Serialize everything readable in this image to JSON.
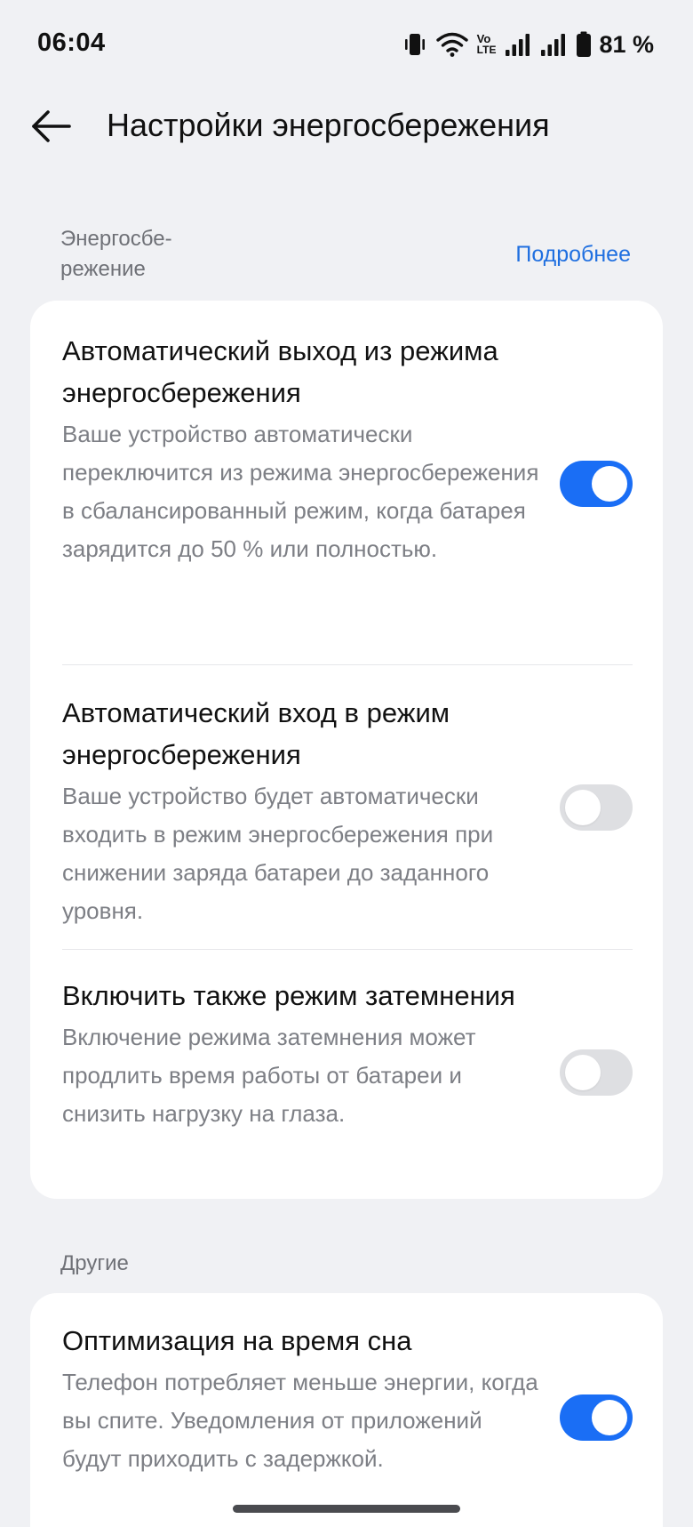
{
  "status_bar": {
    "time": "06:04",
    "battery": "81 %",
    "volte_line1": "Vo",
    "volte_line2": "LTE",
    "icons": [
      "vibrate-icon",
      "wifi-icon",
      "volte-icon",
      "signal-1-icon",
      "signal-2-icon",
      "battery-icon"
    ]
  },
  "header": {
    "back_icon": "arrow-left-icon",
    "title": "Настройки энергосбережения"
  },
  "sections": {
    "power_saving": {
      "label_line1": "Энергосбе-",
      "label_line2": "режение",
      "link": "Подробнее"
    },
    "other": {
      "label": "Другие"
    }
  },
  "settings": [
    {
      "title": "Автоматический выход из режима энергосбережения",
      "description": "Ваше устройство автоматически переключится из режима энергосбережения в сбалансированный режим, когда батарея зарядится до 50 % или полностью.",
      "enabled": true
    },
    {
      "title": "Автоматический вход в режим энергосбережения",
      "description": "Ваше устройство будет автоматически входить в режим энергосбережения при снижении заряда батареи до заданного уровня.",
      "enabled": false
    },
    {
      "title": "Включить также режим затемнения",
      "description": "Включение режима затемнения может продлить время работы от батареи и снизить нагрузку на глаза.",
      "enabled": false
    },
    {
      "title": "Оптимизация на время сна",
      "description": "Телефон потребляет меньше энергии, когда вы спите. Уведомления от приложений будут приходить с задержкой.",
      "enabled": true
    }
  ],
  "colors": {
    "accent": "#1a6ef5",
    "link": "#1f6fe0",
    "background": "#f0f1f4",
    "card": "#ffffff",
    "toggle_off": "#dedfe2"
  }
}
